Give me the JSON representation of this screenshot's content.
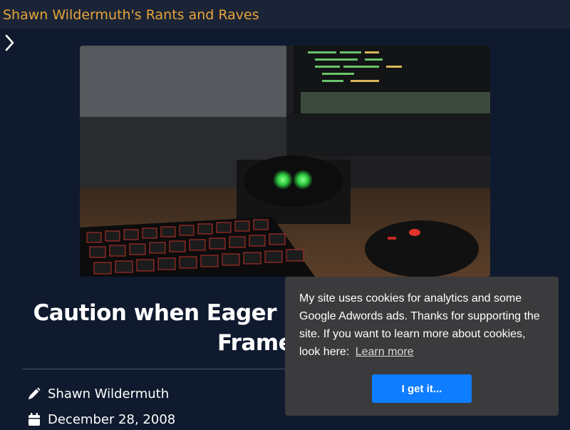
{
  "site": {
    "title": "Shawn Wildermuth's Rants and Raves"
  },
  "nav": {
    "toggle_icon": "chevron-right-icon"
  },
  "hero": {
    "icon": "hero-image-keyboard-desk"
  },
  "post": {
    "title": "Caution when Eager Loading in the Entity Framework",
    "author": "Shawn Wildermuth",
    "date": "December 28, 2008",
    "author_icon": "pencil-icon",
    "date_icon": "calendar-icon"
  },
  "cookie_banner": {
    "message": "My site uses cookies for analytics and some Google Adwords ads. Thanks for supporting the site. If you want to learn more about cookies, look here:",
    "link_label": "Learn more",
    "button_label": "I get it...",
    "colors": {
      "background": "#3b3b3d",
      "button": "#0f7dff"
    }
  },
  "colors": {
    "page_bg": "#0f1a2e",
    "topbar_bg": "#1a2436",
    "accent": "#e8a43a"
  }
}
